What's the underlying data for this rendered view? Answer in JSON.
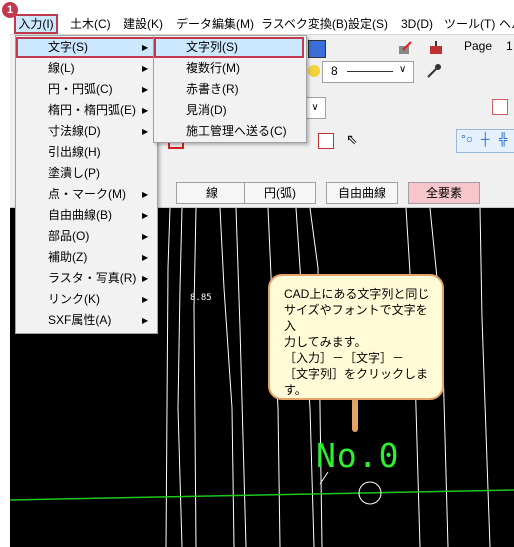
{
  "step_badge": "1",
  "menubar": {
    "items": [
      "入力(I)",
      "土木(C)",
      "建設(K)",
      "データ編集(M)",
      "ラスベク変換(B)",
      "設定(S)",
      "3D(D)",
      "ツール(T)",
      "ヘル"
    ]
  },
  "menu1": {
    "items": [
      {
        "label": "文字(S)",
        "arrow": true
      },
      {
        "label": "線(L)",
        "arrow": true
      },
      {
        "label": "円・円弧(C)",
        "arrow": true
      },
      {
        "label": "楕円・楕円弧(E)",
        "arrow": true
      },
      {
        "label": "寸法線(D)",
        "arrow": true
      },
      {
        "label": "引出線(H)",
        "arrow": false
      },
      {
        "label": "塗潰し(P)",
        "arrow": false
      },
      {
        "label": "点・マーク(M)",
        "arrow": true
      },
      {
        "label": "自由曲線(B)",
        "arrow": true
      },
      {
        "label": "部品(O)",
        "arrow": true
      },
      {
        "label": "補助(Z)",
        "arrow": true
      },
      {
        "label": "ラスタ・写真(R)",
        "arrow": true
      },
      {
        "label": "リンク(K)",
        "arrow": true
      },
      {
        "label": "SXF属性(A)",
        "arrow": true
      }
    ]
  },
  "menu2": {
    "items": [
      "文字列(S)",
      "複数行(M)",
      "赤書き(R)",
      "見消(D)",
      "施工管理へ送る(C)"
    ]
  },
  "toolbar": {
    "page_label": "Page",
    "page_value": "1",
    "line_width_value": "8"
  },
  "tabs": [
    "線",
    "円(弧)",
    "自由曲線",
    "全要素"
  ],
  "canvas": {
    "cad_text": "No.0",
    "small_text": "8.85"
  },
  "callout": {
    "text": "CAD上にある文字列と同じ\nサイズやフォントで文字を入\n力してみます。\n［入力］－［文字］－\n［文字列］をクリックします。"
  },
  "colors": {
    "highlight_border": "#c0394f",
    "menu_highlight": "#cce8ff",
    "cad_green": "#2ef02e",
    "callout_bg": "#fffbd6",
    "callout_border": "#e5a36a"
  }
}
